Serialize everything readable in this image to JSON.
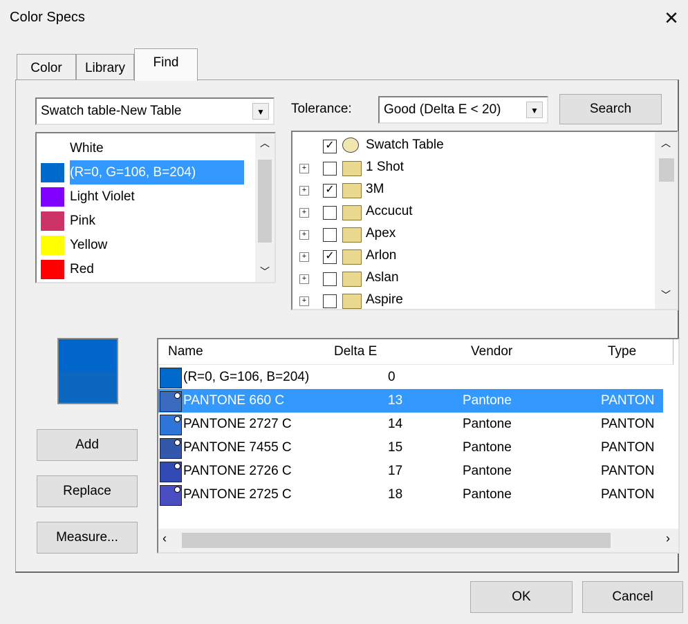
{
  "window": {
    "title": "Color Specs",
    "close_glyph": "✕"
  },
  "tabs": [
    {
      "label": "Color",
      "active": false
    },
    {
      "label": "Library",
      "active": false
    },
    {
      "label": "Find",
      "active": true
    }
  ],
  "find": {
    "swatch_table_select": "Swatch table-New Table",
    "tolerance_label": "Tolerance:",
    "tolerance_value": "Good (Delta E < 20)",
    "search_button": "Search",
    "color_list": [
      {
        "label": "White",
        "color": "#ffffff",
        "selected": false
      },
      {
        "label": "(R=0, G=106, B=204)",
        "color": "#006acc",
        "selected": true
      },
      {
        "label": "Light Violet",
        "color": "#8000ff",
        "selected": false
      },
      {
        "label": "Pink",
        "color": "#cc3366",
        "selected": false
      },
      {
        "label": "Yellow",
        "color": "#ffff00",
        "selected": false
      },
      {
        "label": "Red",
        "color": "#ff0000",
        "selected": false
      }
    ],
    "tree": [
      {
        "label": "Swatch Table",
        "checked": true,
        "icon": "palette-icon"
      },
      {
        "label": "1 Shot",
        "checked": false,
        "icon": "folder-icon"
      },
      {
        "label": "3M",
        "checked": true,
        "icon": "folder-icon"
      },
      {
        "label": "Accucut",
        "checked": false,
        "icon": "folder-icon"
      },
      {
        "label": "Apex",
        "checked": false,
        "icon": "folder-icon"
      },
      {
        "label": "Arlon",
        "checked": true,
        "icon": "open-folder-icon"
      },
      {
        "label": "Aslan",
        "checked": false,
        "icon": "folder-icon"
      },
      {
        "label": "Aspire",
        "checked": false,
        "icon": "folder-icon"
      }
    ],
    "preview_colors": {
      "top": "#0066cc",
      "bottom": "#0b67c0"
    },
    "buttons": {
      "add": "Add",
      "replace": "Replace",
      "measure": "Measure..."
    },
    "results": {
      "columns": [
        "Name",
        "Delta E",
        "Vendor",
        "Type"
      ],
      "rows": [
        {
          "name": "(R=0, G=106, B=204)",
          "delta_e": "0",
          "vendor": "",
          "type": "",
          "color": "#006acc",
          "selected": false,
          "spot": false
        },
        {
          "name": "PANTONE 660 C",
          "delta_e": "13",
          "vendor": "Pantone",
          "type": "PANTON",
          "color": "#3a6bbf",
          "selected": true,
          "spot": true
        },
        {
          "name": "PANTONE 2727 C",
          "delta_e": "14",
          "vendor": "Pantone",
          "type": "PANTON",
          "color": "#2e76d9",
          "selected": false,
          "spot": true
        },
        {
          "name": "PANTONE 7455 C",
          "delta_e": "15",
          "vendor": "Pantone",
          "type": "PANTON",
          "color": "#3358ab",
          "selected": false,
          "spot": true
        },
        {
          "name": "PANTONE 2726 C",
          "delta_e": "17",
          "vendor": "Pantone",
          "type": "PANTON",
          "color": "#3049b5",
          "selected": false,
          "spot": true
        },
        {
          "name": "PANTONE 2725 C",
          "delta_e": "18",
          "vendor": "Pantone",
          "type": "PANTON",
          "color": "#4b4ec3",
          "selected": false,
          "spot": true
        }
      ]
    }
  },
  "footer": {
    "ok": "OK",
    "cancel": "Cancel"
  }
}
